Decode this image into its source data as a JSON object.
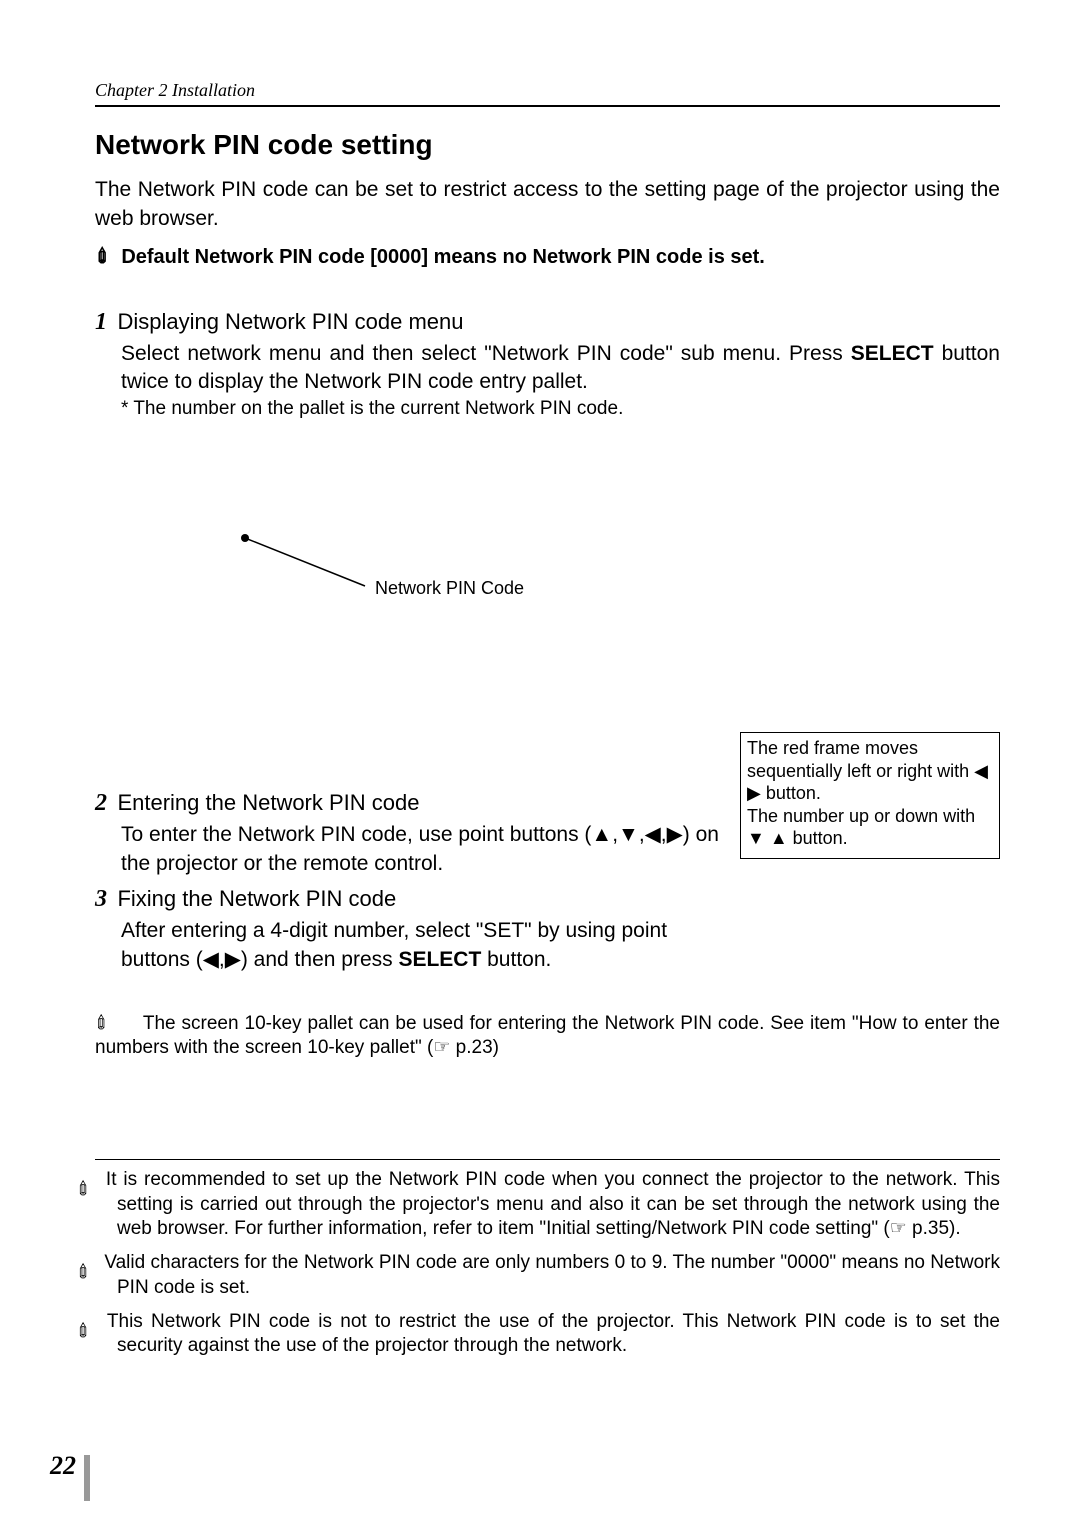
{
  "chapter": "Chapter 2 Installation",
  "title": "Network PIN code setting",
  "intro": "The Network PIN code can be set to restrict access to the setting page of the projector using the web browser.",
  "default_note_prefix": "✐",
  "default_note": " Default Network PIN code [0000] means no Network PIN code is set.",
  "step1": {
    "num": "1",
    "title": "Displaying Network PIN code menu",
    "body_a": "Select network menu and then select \"Network PIN code\" sub menu. Press",
    "body_select": "SELECT",
    "body_b": " button twice to display the Network PIN code entry pallet.",
    "note": "* The number on the pallet is the current Network PIN code."
  },
  "callout_label": "Network PIN Code",
  "help_box": {
    "line1": "The red frame moves sequentially left or right with ◀ ▶ button.",
    "line2": "The number up or down with ▼ ▲ button."
  },
  "step2": {
    "num": "2",
    "title": "Entering the Network PIN code",
    "body_a": "To enter the Network PIN code, use point buttons (",
    "arrows": "▲,▼,◀,▶",
    "body_b": ") on the projector or the remote control."
  },
  "step3": {
    "num": "3",
    "title": "Fixing the Network PIN code",
    "body_a": "After entering a 4-digit number, select \"SET\" by using point buttons (",
    "arrows": "◀,▶",
    "body_b": ") and then press ",
    "select": "SELECT",
    "body_c": " button."
  },
  "ten_key_note": "The screen 10-key pallet can be used for entering the Network PIN code. See item \"How to enter the numbers with the screen 10-key pallet\" (☞ p.23)",
  "footer": {
    "n1": "It is recommended to set up the Network PIN code when you connect the projector to the network. This setting is carried out through the projector's menu and also it can be set through the network using the web browser. For further information, refer to item \"Initial setting/Network PIN code setting\" (☞ p.35).",
    "n2": "Valid characters for the Network PIN code are only numbers 0 to 9. The number \"0000\" means no Network PIN code is set.",
    "n3": "This Network PIN code is not to restrict the use of the projector. This Network PIN code is to set the security against the use of the projector through the network."
  },
  "page_number": "22"
}
